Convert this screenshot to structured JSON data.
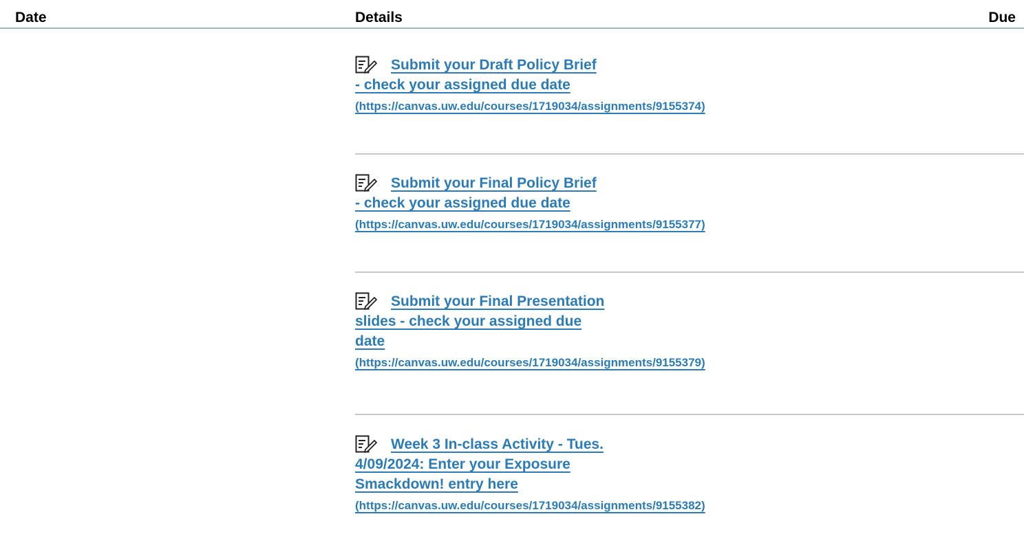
{
  "table": {
    "headers": {
      "date": "Date",
      "details": "Details",
      "due": "Due"
    },
    "rows": [
      {
        "title_lines": [
          "Submit your Draft Policy Brief",
          "- check your assigned due date"
        ],
        "url": "(https://canvas.uw.edu/courses/1719034/assignments/9155374)",
        "icon": "assignment-icon"
      },
      {
        "title_lines": [
          "Submit your Final Policy Brief",
          "- check your assigned due date"
        ],
        "url": "(https://canvas.uw.edu/courses/1719034/assignments/9155377)",
        "icon": "assignment-icon"
      },
      {
        "title_lines": [
          "Submit your Final Presentation",
          "slides - check your assigned due",
          "date"
        ],
        "url": "(https://canvas.uw.edu/courses/1719034/assignments/9155379)",
        "icon": "assignment-icon"
      },
      {
        "title_lines": [
          "Week 3 In-class Activity - Tues.",
          "4/09/2024: Enter your Exposure",
          "Smackdown! entry here"
        ],
        "url": "(https://canvas.uw.edu/courses/1719034/assignments/9155382)",
        "icon": "assignment-icon"
      }
    ]
  },
  "colors": {
    "link": "#2c7bb6",
    "header_rule": "#a3b2bf",
    "row_rule": "#c8c8c8"
  }
}
